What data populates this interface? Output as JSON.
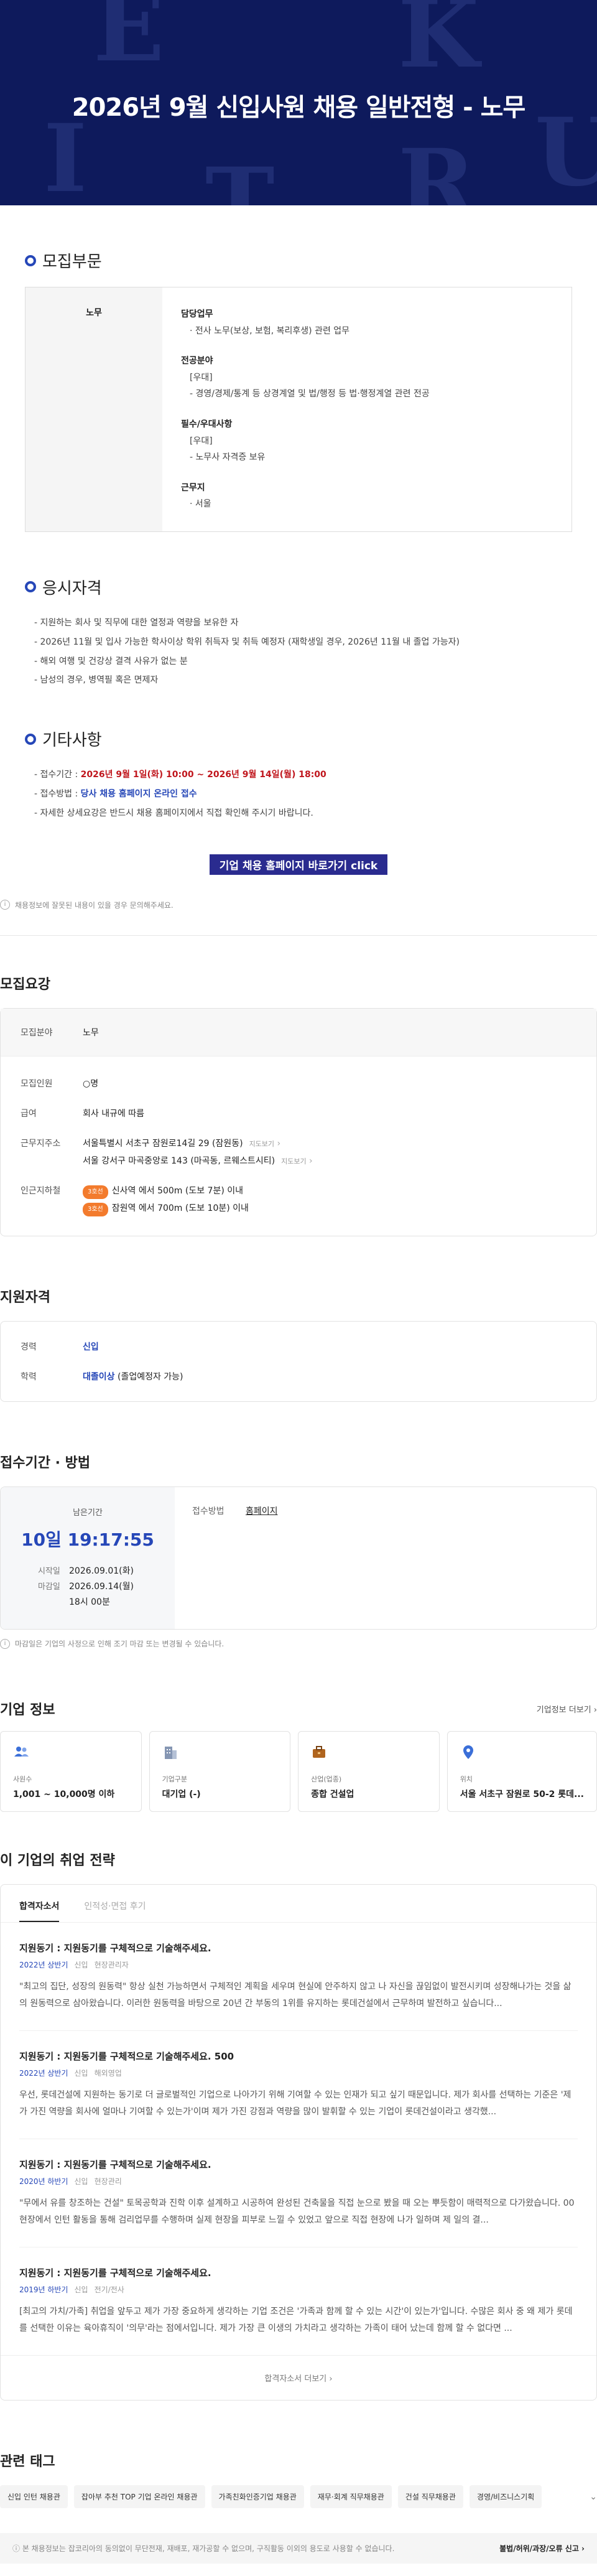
{
  "hero": {
    "title": "2026년 9월 신입사원 채용 일반전형 - 노무",
    "deco_letters": [
      "E",
      "K",
      "I",
      "U",
      "R",
      "T"
    ]
  },
  "posting": {
    "recruit_section_title": "모집부문",
    "department": "노무",
    "duties": {
      "label": "담당업무",
      "items": [
        "전사 노무(보상, 보험, 복리후생) 관련 업무"
      ]
    },
    "major": {
      "label": "전공분야",
      "items": [
        "[우대]",
        "- 경영/경제/통계 등 상경계열 및 법/행정 등 법·행정계열 관련 전공"
      ]
    },
    "requirements": {
      "label": "필수/우대사항",
      "items": [
        "[우대]",
        "- 노무사 자격증 보유"
      ]
    },
    "location": {
      "label": "근무지",
      "items": [
        "서울"
      ]
    },
    "eligibility_title": "응시자격",
    "eligibility": [
      "지원하는 회사 및 직무에 대한 열정과 역량을 보유한 자",
      "2026년 11월 및 입사 가능한 학사이상 학위 취득자 및 취득 예정자 (재학생일 경우, 2026년 11월 내 졸업 가능자)",
      "해외 여행 및 건강상 결격 사유가 없는 분",
      "남성의 경우, 병역필 혹은 면제자"
    ],
    "etc_title": "기타사항",
    "etc": {
      "period_label": "접수기간 : ",
      "period_value": "2026년 9월 1일(화) 10:00 ~ 2026년 9월 14일(월) 18:00",
      "method_label": "접수방법 : ",
      "method_value": "당사 채용 홈페이지 온라인 접수",
      "detail": "자세한 상세요강은 반드시 채용 홈페이지에서 직접 확인해 주시기 바랍니다."
    },
    "cta_label": "기업 채용 홈페이지 바로가기 click",
    "change_notice": "채용정보에 잘못된 내용이 있을 경우 문의해주세요."
  },
  "summary": {
    "title": "모집요강",
    "field_label": "모집분야",
    "field_value": "노무",
    "headcount_label": "모집인원",
    "headcount_value": "○명",
    "salary_label": "급여",
    "salary_value": "회사 내규에 따름",
    "address_label": "근무지주소",
    "addresses": [
      "서울특별시 서초구 잠원로14길 29 (잠원동)",
      "서울 강서구 마곡중앙로 143 (마곡동, 르웨스트시티)"
    ],
    "map_link": "지도보기",
    "subway_label": "인근지하철",
    "subway": [
      {
        "line": "3호선",
        "text": "신사역 에서 500m (도보 7분) 이내",
        "color": "#f37b2d"
      },
      {
        "line": "3호선",
        "text": "잠원역 에서 700m (도보 10분) 이내",
        "color": "#f37b2d"
      }
    ]
  },
  "qualification": {
    "title": "지원자격",
    "career_label": "경력",
    "career_value": "신입",
    "edu_label": "학력",
    "edu_value": "대졸이상",
    "edu_note": " (졸업예정자 가능)"
  },
  "period": {
    "title": "접수기간 · 방법",
    "remain_label": "남은기간",
    "remain_value": "10일 19:17:55",
    "start_label": "시작일",
    "start_value": "2026.09.01(화)",
    "end_label": "마감일",
    "end_value": "2026.09.14(월)",
    "end_time": "18시 00분",
    "method_label": "접수방법",
    "method_value": "홈페이지",
    "notice": "마감일은 기업의 사정으로 인해 조기 마감 또는 변경될 수 있습니다."
  },
  "company": {
    "title": "기업 정보",
    "more": "기업정보 더보기",
    "cards": [
      {
        "icon": "people-icon",
        "label": "사원수",
        "value": "1,001 ~ 10,000명 이하",
        "color": "#3b6fd8"
      },
      {
        "icon": "building-icon",
        "label": "기업구분",
        "value": "대기업 (-)",
        "color": "#7a8aa6"
      },
      {
        "icon": "briefcase-icon",
        "label": "산업(업종)",
        "value": "종합 건설업",
        "color": "#b0651f"
      },
      {
        "icon": "location-pin-icon",
        "label": "위치",
        "value": "서울 서초구 잠원로 50-2 롯데...",
        "color": "#3b6fd8"
      }
    ]
  },
  "strategy": {
    "title": "이 기업의 취업 전략",
    "tabs": [
      "합격자소서",
      "인적성·면접 후기"
    ],
    "essays": [
      {
        "q": "지원동기 : 지원동기를 구체적으로 기술해주세요.",
        "sem": "2022년 상반기",
        "type": "신입",
        "job": "현장관리자",
        "text": "\"최고의 집단, 성장의 원동력\" 항상 실천 가능하면서 구체적인 계획을 세우며 현실에 안주하지 않고 나 자신을 끊임없이 발전시키며 성장해나가는 것을 삶의 원동력으로 삼아왔습니다. 이러한 원동력을 바탕으로 20년 간 부동의 1위를 유지하는 롯데건설에서 근무하며 발전하고 싶습니다..."
      },
      {
        "q": "지원동기 : 지원동기를 구체적으로 기술해주세요. 500",
        "sem": "2022년 상반기",
        "type": "신입",
        "job": "해외영업",
        "text": "우선, 롯데건설에 지원하는 동기로 더 글로벌적인 기업으로 나아가기 위해 기여할 수 있는 인재가 되고 싶기 때문입니다. 제가 회사를 선택하는 기준은 '제가 가진 역량을 회사에 얼마나 기여할 수 있는가'이며 제가 가진 강점과 역량을 많이 발휘할 수 있는 기업이 롯데건설이라고 생각했..."
      },
      {
        "q": "지원동기 : 지원동기를 구체적으로 기술해주세요.",
        "sem": "2020년 하반기",
        "type": "신입",
        "job": "현장관리",
        "text": "\"무에서 유를 창조하는 건설\" 토목공학과 진학 이후 설계하고 시공하여 완성된 건축물을 직접 눈으로 봤을 때 오는 뿌듯함이 매력적으로 다가왔습니다. 00현장에서 인턴 활동을 통해 검리업무를 수행하며 실제 현장을 피부로 느낄 수 있었고 앞으로 직접 현장에 나가 일하며 제 일의 결..."
      },
      {
        "q": "지원동기 : 지원동기를 구체적으로 기술해주세요.",
        "sem": "2019년 하반기",
        "type": "신입",
        "job": "전기/전사",
        "text": "[최고의 가치/가족] 취업을 앞두고 제가 가장 중요하게 생각하는 기업 조건은 '가족과 함께 할 수 있는 시간'이 있는가'입니다. 수많은 회사 중 왜 제가 롯데를 선택한 이유는 육아휴직이 '의무'라는 점에서입니다. 제가 가장 큰 이생의 가치라고 생각하는 가족이 태어 났는데 함께 할 수 없다면 ..."
      }
    ],
    "more": "합격자소서 더보기"
  },
  "tags": {
    "title": "관련 태그",
    "items": [
      "신입 인턴 채용관",
      "잡아부 추천 TOP 기업 온라인 채용관",
      "가족친화인증기업 채용관",
      "재무·회계 직무채용관",
      "건설 직무채용관",
      "경영/비즈니스기획"
    ]
  },
  "footer": {
    "note": "본 채용정보는 잡코리아의 동의없이 무단전재, 재배포, 재가공할 수 없으며, 구직활동 이외의 용도로 사용할 수 없습니다.",
    "report": "불법/허위/과장/오류 신고"
  }
}
